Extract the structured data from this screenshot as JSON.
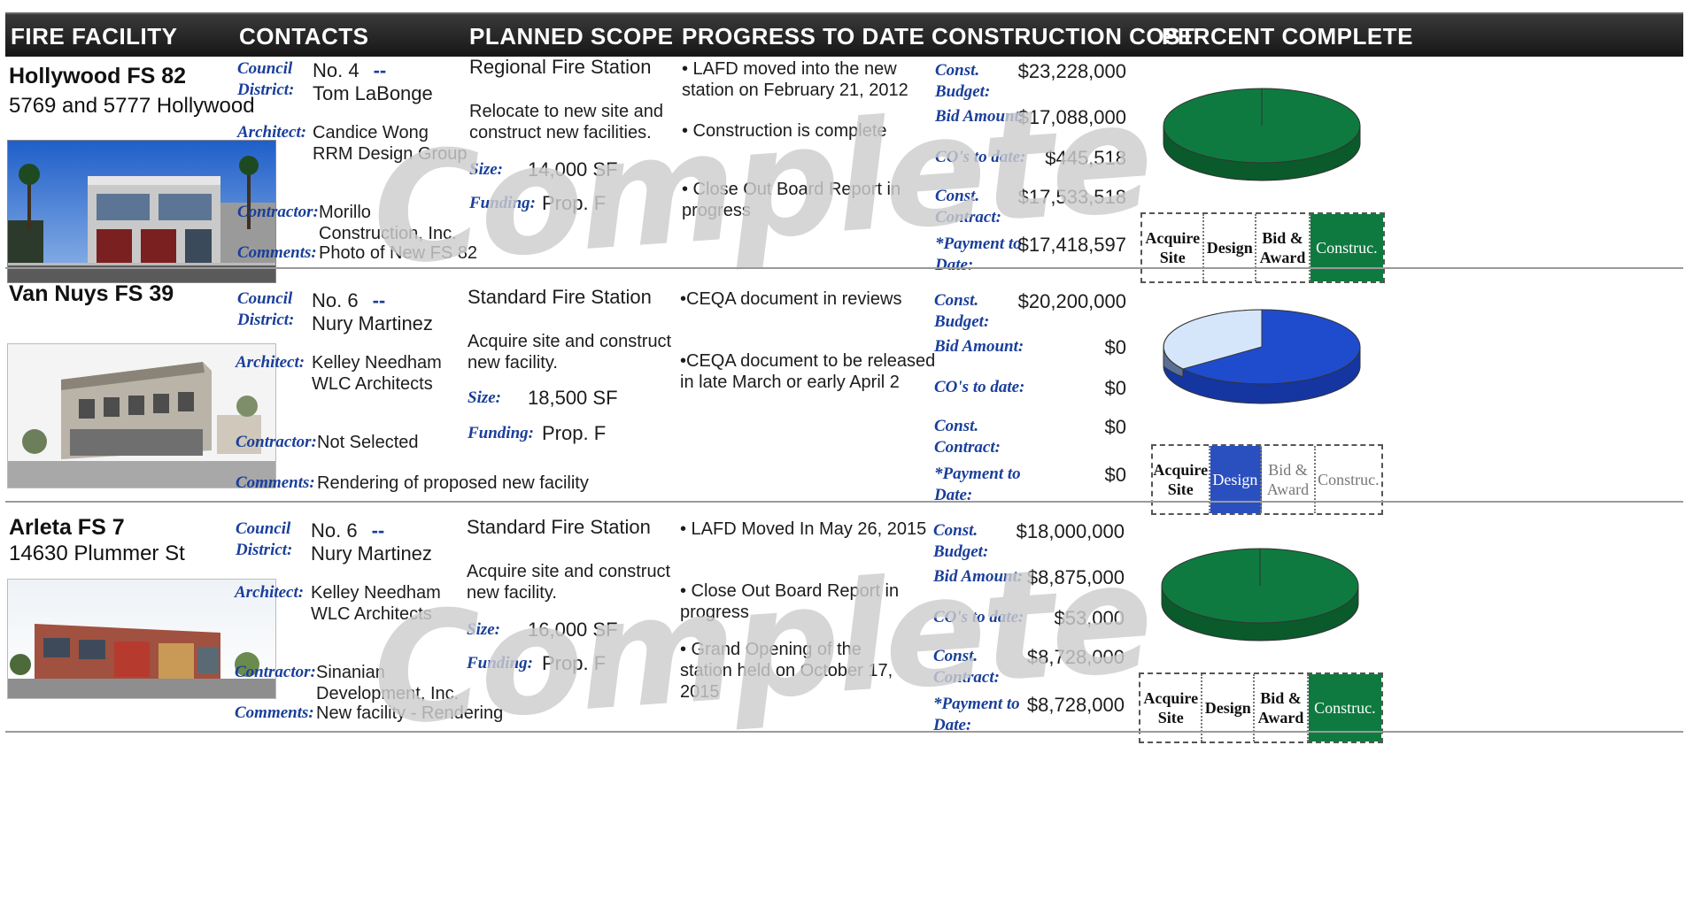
{
  "header": {
    "fire_facility": "FIRE FACILITY",
    "contacts": "CONTACTS",
    "planned_scope": "PLANNED SCOPE",
    "progress_to_date": "PROGRESS TO DATE",
    "construction_cost": "CONSTRUCTION COST",
    "percent_complete": "PERCENT COMPLETE"
  },
  "labels": {
    "council_district_1": "Council",
    "council_district_2": "District:",
    "architect": "Architect:",
    "contractor": "Contractor:",
    "comments": "Comments:",
    "size": "Size:",
    "funding": "Funding:",
    "const_budget_1": "Const.",
    "const_budget_2": "Budget:",
    "bid_amount": "Bid Amount:",
    "cos_to_date": "CO's to date:",
    "const_contract_1": "Const.",
    "const_contract_2": "Contract:",
    "payment_1": "*Payment to",
    "payment_2": "Date:"
  },
  "phases": {
    "acquire_1": "Acquire",
    "acquire_2": "Site",
    "design": "Design",
    "bid_1": "Bid &",
    "bid_2": "Award",
    "construction": "Construc."
  },
  "stamp_text": "Complete",
  "facilities": [
    {
      "name": "Hollywood FS 82",
      "address": "5769 and 5777 Hollywood",
      "district_no": "No. 4",
      "district_dash": "--",
      "councilmember": "Tom LaBonge",
      "architect_1": "Candice Wong",
      "architect_2": "RRM Design Group",
      "contractor_1": "Morillo",
      "contractor_2": "Construction, Inc.",
      "comments": "Photo of New FS 82",
      "scope_type": "Regional Fire Station",
      "scope_1": "Relocate to new site and",
      "scope_2": "construct new facilities.",
      "size": "14,000 SF",
      "funding": "Prop. F",
      "progress_1": "• LAFD moved into the new",
      "progress_2": "station on February 21, 2012",
      "progress_3": "• Construction is complete",
      "progress_4": "• Close Out Board Report in",
      "progress_5": "progress",
      "const_budget": "$23,228,000",
      "bid_amount": "$17,088,000",
      "cos_to_date": "$445,518",
      "const_contract": "$17,533,518",
      "payment_to_date": "$17,418,597",
      "percent_complete": 1.0,
      "active_phase": "construction",
      "complete": true
    },
    {
      "name": "Van Nuys FS 39",
      "address": "",
      "district_no": "No. 6",
      "district_dash": "--",
      "councilmember": "Nury Martinez",
      "architect_1": "Kelley Needham",
      "architect_2": "WLC Architects",
      "contractor_1": "Not Selected",
      "contractor_2": "",
      "comments": "Rendering of proposed new facility",
      "scope_type": "Standard Fire Station",
      "scope_1": "Acquire site and construct",
      "scope_2": "new facility.",
      "size": "18,500  SF",
      "funding": "Prop. F",
      "progress_1": "•CEQA document in reviews",
      "progress_2": "",
      "progress_3": "•CEQA document to be released",
      "progress_4": "in late March or early April 2",
      "progress_5": "",
      "const_budget": "$20,200,000",
      "bid_amount": "$0",
      "cos_to_date": "$0",
      "const_contract": "$0",
      "payment_to_date": "$0",
      "percent_complete": 0.7,
      "active_phase": "design",
      "complete": false
    },
    {
      "name": "Arleta FS 7",
      "address": "14630 Plummer St",
      "district_no": "No. 6",
      "district_dash": "--",
      "councilmember": "Nury Martinez",
      "architect_1": "Kelley Needham",
      "architect_2": "WLC Architects",
      "contractor_1": "Sinanian",
      "contractor_2": "Development, Inc.",
      "comments": "New facility - Rendering",
      "scope_type": "Standard Fire Station",
      "scope_1": "Acquire site and construct",
      "scope_2": "new facility.",
      "size": "16,000 SF",
      "funding": "Prop. F",
      "progress_1": "• LAFD Moved In May 26, 2015",
      "progress_2": "",
      "progress_3": "• Close Out Board Report in",
      "progress_4": "progress",
      "progress_5": "• Grand Opening of the station held on October 17, 2015",
      "const_budget": "$18,000,000",
      "bid_amount": "$8,875,000",
      "cos_to_date": "$53,000",
      "const_contract": "$8,728,000",
      "payment_to_date": "$8,728,000",
      "percent_complete": 1.0,
      "active_phase": "construction",
      "complete": true
    }
  ],
  "colors": {
    "label_blue": "#1a3f9a",
    "pie_green": "#0f7a3f",
    "pie_blue": "#1f4ccc",
    "pie_light": "#d6e6fa",
    "phase_design_blue": "#2a4fbf",
    "phase_construc_green": "#0f7a3f"
  }
}
